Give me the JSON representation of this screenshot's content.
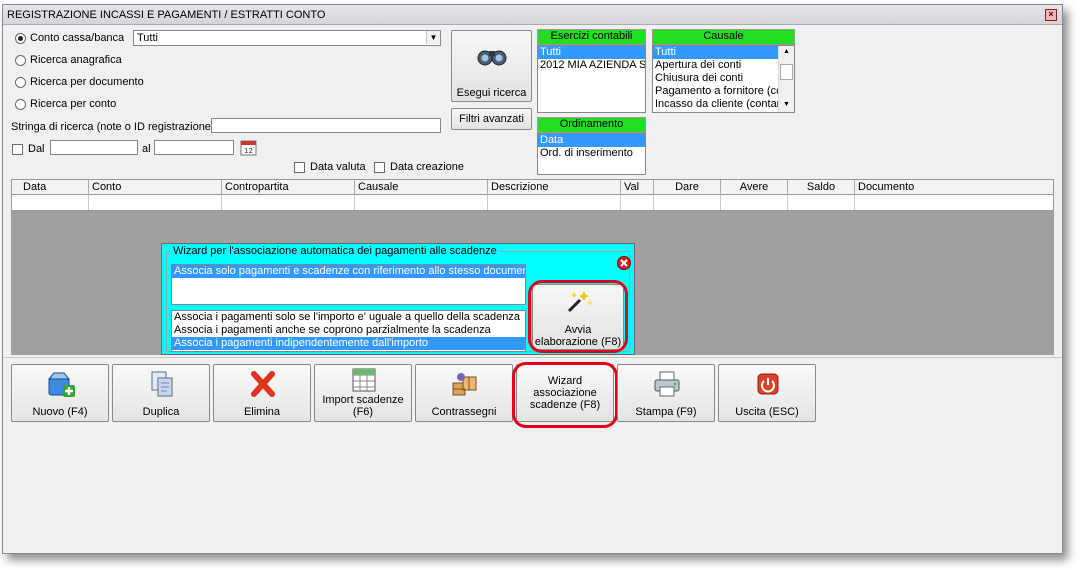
{
  "window": {
    "title": "REGISTRAZIONE INCASSI E PAGAMENTI / ESTRATTI CONTO"
  },
  "search": {
    "radio_options": [
      "Conto cassa/banca",
      "Ricerca anagrafica",
      "Ricerca per documento",
      "Ricerca per conto"
    ],
    "selected_option": "Conto cassa/banca",
    "account_value": "Tutti",
    "search_string_label": "Stringa di ricerca (note o ID registrazione)",
    "search_string_value": "",
    "dal_label": "Dal",
    "al_label": "al",
    "data_valuta_label": "Data valuta",
    "data_creazione_label": "Data creazione",
    "esegui_ricerca_label": "Esegui ricerca",
    "filtri_avanzati_label": "Filtri avanzati"
  },
  "esercizi": {
    "header": "Esercizi contabili",
    "items": [
      "Tutti",
      "2012 MIA AZIENDA S"
    ],
    "selected": "Tutti"
  },
  "ordinamento": {
    "header": "Ordinamento",
    "items": [
      "Data",
      "Ord. di inserimento"
    ],
    "selected": "Data"
  },
  "causale": {
    "header": "Causale",
    "items": [
      "Tutti",
      "Apertura dei conti",
      "Chiusura dei conti",
      "Pagamento a fornitore (co",
      "Incasso da cliente (contar"
    ],
    "selected": "Tutti"
  },
  "grid": {
    "columns": [
      "Data",
      "Conto",
      "Contropartita",
      "Causale",
      "Descrizione",
      "Val",
      "Dare",
      "Avere",
      "Saldo",
      "Documento"
    ]
  },
  "wizard": {
    "title": "Wizard per l'associazione automatica dei pagamenti alle scadenze",
    "top_list": [
      "Associa solo pagamenti e scadenze con riferimento allo stesso documento"
    ],
    "top_selected": "Associa solo pagamenti e scadenze con riferimento allo stesso documento",
    "bottom_list": [
      "Associa i pagamenti solo se l'importo e' uguale a quello della scadenza",
      "Associa i pagamenti anche se coprono parzialmente la scadenza",
      "Associa i pagamenti indipendentemente dall'importo"
    ],
    "bottom_selected": "Associa i pagamenti indipendentemente dall'importo",
    "run_label_1": "Avvia",
    "run_label_2": "elaborazione (F8)"
  },
  "toolbar": {
    "nuovo": "Nuovo (F4)",
    "duplica": "Duplica",
    "elimina": "Elimina",
    "import_1": "Import scadenze",
    "import_2": "(F6)",
    "contrassegni": "Contrassegni",
    "wizard_1": "Wizard",
    "wizard_2": "associazione",
    "wizard_3": "scadenze (F8)",
    "stampa": "Stampa (F9)",
    "uscita": "Uscita (ESC)"
  },
  "colors": {
    "highlight": "#3399ff",
    "green_header": "#22dd22",
    "wizard_bg": "#00ffff",
    "callout_red": "#e3001b",
    "grid_empty": "#a0a0a0"
  }
}
